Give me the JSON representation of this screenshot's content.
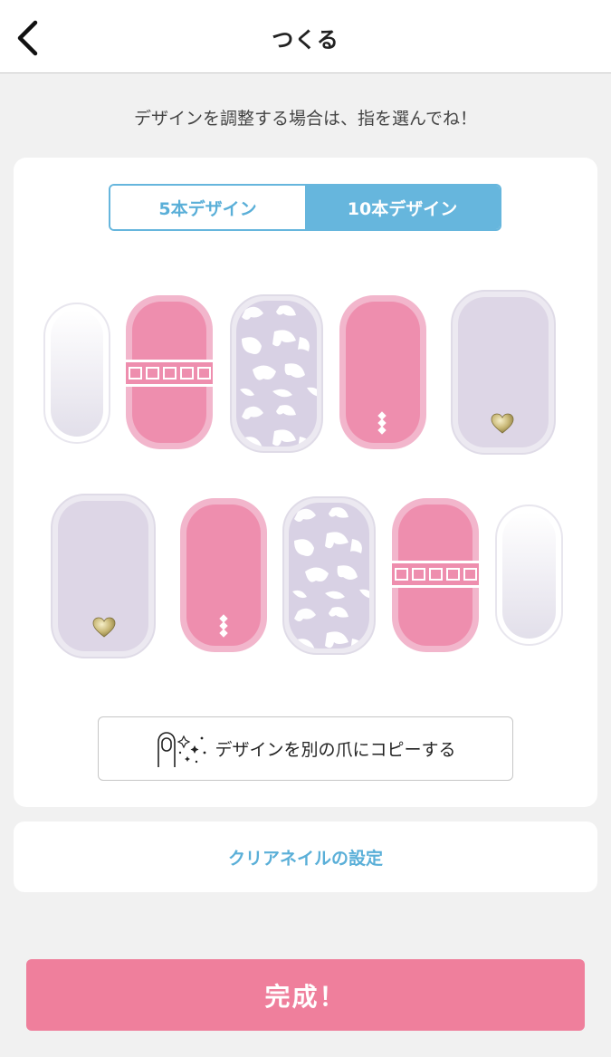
{
  "header": {
    "title": "つくる",
    "back_icon": "chevron-left-icon"
  },
  "instruction": "デザインを調整する場合は、指を選んでね！",
  "design_tabs": [
    {
      "label": "5本デザイン",
      "selected": false
    },
    {
      "label": "10本デザイン",
      "selected": true
    }
  ],
  "nails": {
    "row1": [
      "clear-white",
      "pink-stripe",
      "leopard",
      "pink-rhinestone",
      "lavender-heart"
    ],
    "row2": [
      "lavender-heart",
      "pink-rhinestone",
      "leopard",
      "pink-stripe",
      "clear-white"
    ]
  },
  "copy_button": {
    "label": "デザインを別の爪にコピーする",
    "icon": "nail-sparkle-icon"
  },
  "clear_nail_setting": "クリアネイルの設定",
  "done_button": "完成！",
  "colors": {
    "accent_blue": "#66b6dd",
    "nail_pink": "#ee8eae",
    "nail_pink_border": "#f2b6cc",
    "nail_lavender": "#ddd6e6",
    "done_pink": "#ef7f9c",
    "background": "#f1f1f1"
  }
}
